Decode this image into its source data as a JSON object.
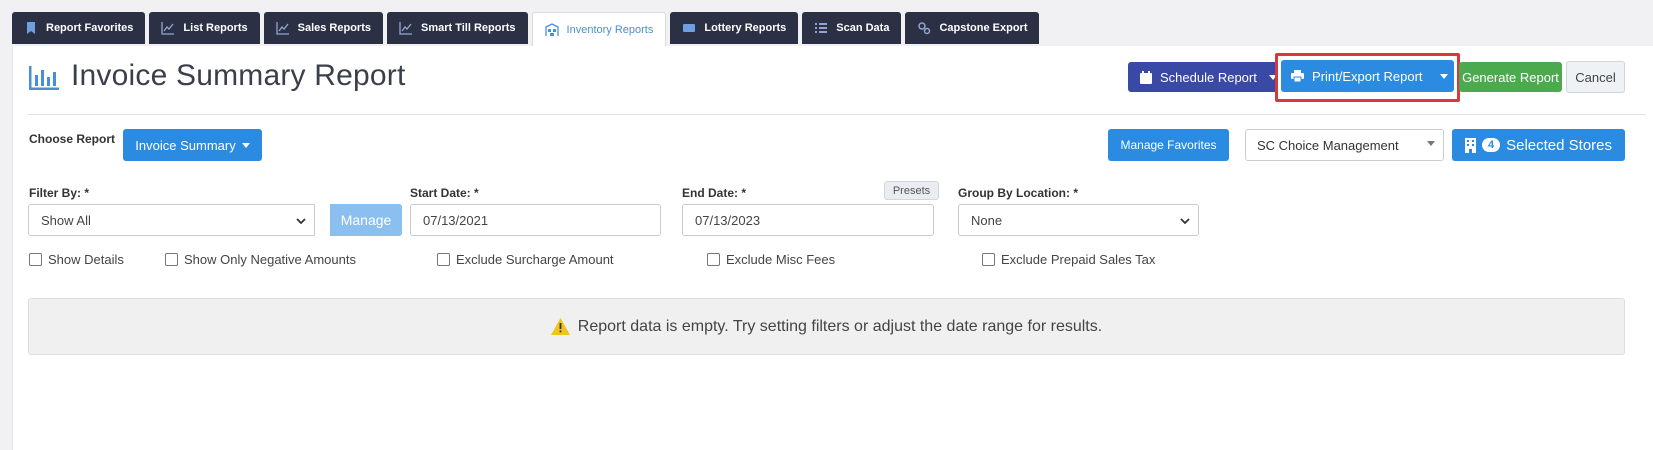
{
  "tabs": [
    {
      "label": "Report Favorites",
      "icon": "bookmark-icon"
    },
    {
      "label": "List Reports",
      "icon": "line-chart-icon"
    },
    {
      "label": "Sales Reports",
      "icon": "line-chart-icon"
    },
    {
      "label": "Smart Till Reports",
      "icon": "line-chart-icon"
    },
    {
      "label": "Inventory Reports",
      "icon": "warehouse-icon",
      "active": true
    },
    {
      "label": "Lottery Reports",
      "icon": "ticket-icon"
    },
    {
      "label": "Scan Data",
      "icon": "list-icon"
    },
    {
      "label": "Capstone Export",
      "icon": "cogs-icon"
    }
  ],
  "page": {
    "title": "Invoice Summary Report",
    "icon": "bar-chart-icon"
  },
  "toolbar": {
    "schedule_label": "Schedule Report",
    "print_label": "Print/Export Report",
    "generate_label": "Generate Report",
    "cancel_label": "Cancel"
  },
  "report": {
    "choose_label": "Choose Report",
    "selected": "Invoice Summary",
    "manage_favorites_label": "Manage Favorites",
    "management": "SC Choice Management",
    "stores_count": "4",
    "stores_label": "Selected Stores"
  },
  "filters": {
    "filter_by_label": "Filter By: *",
    "filter_by_value": "Show All",
    "manage_label": "Manage",
    "start_date_label": "Start Date: *",
    "start_date_value": "07/13/2021",
    "end_date_label": "End Date: *",
    "end_date_value": "07/13/2023",
    "presets_label": "Presets",
    "group_by_label": "Group By Location: *",
    "group_by_value": "None"
  },
  "checkboxes": {
    "show_details": "Show Details",
    "show_negative": "Show Only Negative Amounts",
    "exclude_surcharge": "Exclude Surcharge Amount",
    "exclude_misc": "Exclude Misc Fees",
    "exclude_prepaid": "Exclude Prepaid Sales Tax"
  },
  "alert": {
    "message": "Report data is empty. Try setting filters or adjust the date range for results."
  },
  "colors": {
    "navy_tab": "#2b3045",
    "primary": "#2a8be0",
    "schedule": "#3a49a6",
    "success": "#4caa4e",
    "highlight": "#d63a3a"
  }
}
